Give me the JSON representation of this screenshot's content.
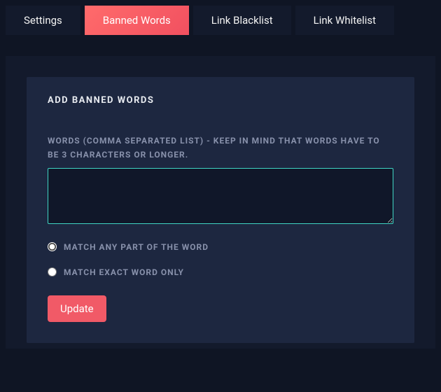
{
  "tabs": {
    "settings": "Settings",
    "banned_words": "Banned Words",
    "link_blacklist": "Link Blacklist",
    "link_whitelist": "Link Whitelist",
    "active": "banned_words"
  },
  "panel": {
    "title": "Add Banned Words",
    "field_label": "Words (comma separated list) - Keep in mind that words have to be 3 characters or longer.",
    "textarea_value": "",
    "match_mode": "any",
    "radio_any_label": "Match any part of the word",
    "radio_exact_label": "Match exact word only",
    "update_label": "Update"
  },
  "colors": {
    "bg": "#0f1524",
    "tab_bg": "#131a2c",
    "tab_active": "#f15a67",
    "panel_bg": "#1d2740",
    "input_bg": "#101729",
    "input_border": "#3fd6c4",
    "muted_text": "#8891ab",
    "text": "#e8ebf0"
  }
}
